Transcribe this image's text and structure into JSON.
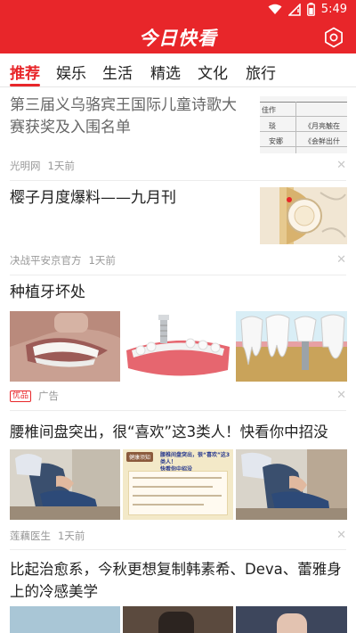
{
  "status_bar": {
    "time": "5:49",
    "icons": [
      "wifi-icon",
      "signal-icon",
      "battery-icon"
    ]
  },
  "app": {
    "title": "今日快看",
    "settings_icon": "settings-icon"
  },
  "tabs": [
    {
      "label": "推荐",
      "active": true
    },
    {
      "label": "娱乐",
      "active": false
    },
    {
      "label": "生活",
      "active": false
    },
    {
      "label": "精选",
      "active": false
    },
    {
      "label": "文化",
      "active": false
    },
    {
      "label": "旅行",
      "active": false
    }
  ],
  "feed": [
    {
      "title_line1": "第三届义乌骆宾王国际儿童诗歌大",
      "title_line2": "赛获奖及入围名单",
      "source": "光明网",
      "time": "1天前",
      "thumb_text": [
        "佳作",
        "琰",
        "安娜"
      ],
      "thumb_text2": [
        "《月亮触在",
        "《会鲜出什"
      ]
    },
    {
      "title_line1": "樱子月度爆料——九月刊",
      "source": "决战平安京官方",
      "time": "1天前"
    },
    {
      "title_line1": "种植牙坏处",
      "ad_badge": "优品",
      "ad_label": "广告"
    },
    {
      "title_line1": "腰椎间盘突出，很“喜欢”这3类人！快看你中招没",
      "source": "莲藕医生",
      "time": "1天前",
      "card_badge": "健康须知",
      "card_title_line1": "腰椎间盘突出，很“喜欢”这3类人！",
      "card_title_line2": "快看你中招没"
    },
    {
      "title_line1": "比起治愈系，今秋更想复制韩素希、Deva、蕾雅身",
      "title_line2": "上的冷感美学"
    }
  ],
  "colors": {
    "brand_red": "#e8262a",
    "meta_gray": "#999999",
    "divider": "#ececec"
  }
}
